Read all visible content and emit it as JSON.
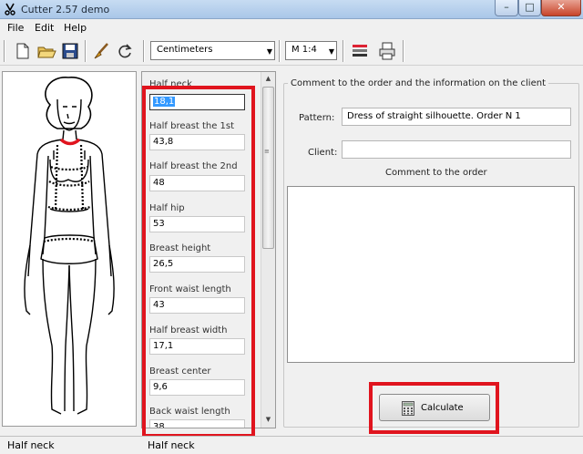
{
  "window": {
    "title": "Cutter 2.57 demo",
    "min": "–",
    "max": "□",
    "close": "✕"
  },
  "menu": [
    "File",
    "Edit",
    "Help"
  ],
  "toolbar": {
    "unit_select": "Centimeters",
    "scale_select": "M 1:4"
  },
  "measurements": [
    {
      "label": "Half neck",
      "value": "18,1"
    },
    {
      "label": "Half breast the 1st",
      "value": "43,8"
    },
    {
      "label": "Half breast the 2nd",
      "value": "48"
    },
    {
      "label": "Half hip",
      "value": "53"
    },
    {
      "label": "Breast height",
      "value": "26,5"
    },
    {
      "label": "Front waist length",
      "value": "43"
    },
    {
      "label": "Half breast width",
      "value": "17,1"
    },
    {
      "label": "Breast center",
      "value": "9,6"
    },
    {
      "label": "Back waist length",
      "value": "38"
    }
  ],
  "order": {
    "group_title": "Comment to the order and the information on the client",
    "pattern_label": "Pattern:",
    "pattern_value": "Dress of straight silhouette. Order N 1",
    "client_label": "Client:",
    "client_value": "",
    "comment_label": "Comment to the order",
    "comment_value": ""
  },
  "calculate_label": "Calculate",
  "status": {
    "left": "Half neck",
    "right": "Half neck"
  },
  "colors": {
    "highlight": "#e0141e",
    "selection": "#3399ff"
  }
}
